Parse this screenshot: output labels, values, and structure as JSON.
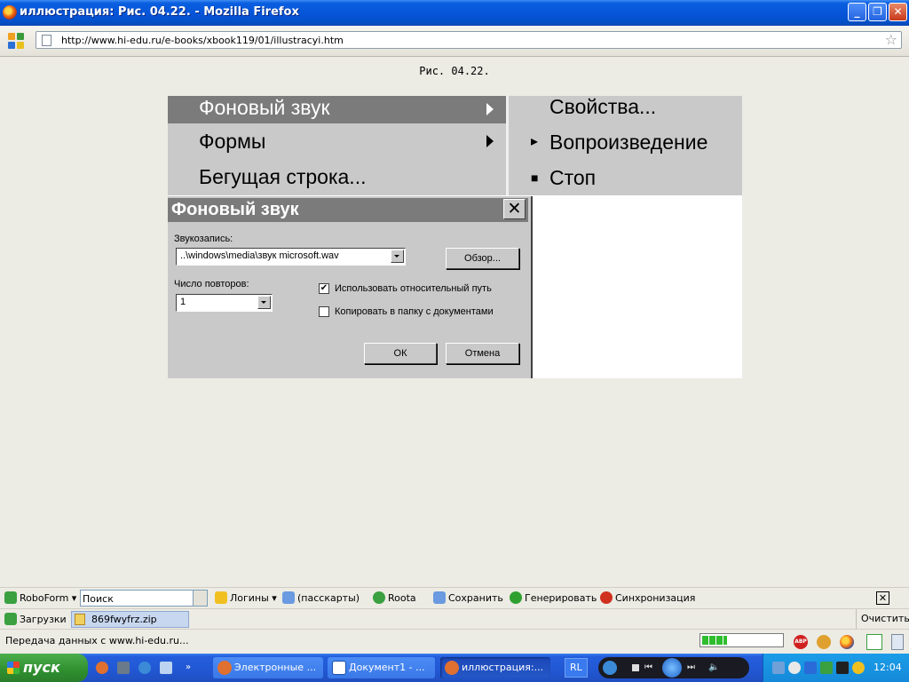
{
  "window": {
    "title": "иллюстрация: Рис. 04.22. - Mozilla Firefox",
    "btn_min": "_",
    "btn_max": "❐",
    "btn_close": "✕"
  },
  "nav": {
    "url": "http://www.hi-edu.ru/e-books/xbook119/01/illustracyi.htm",
    "bookmark_icon": "☆"
  },
  "page": {
    "caption": "Рис. 04.22.",
    "menu_left": [
      {
        "label": "Фоновый звук"
      },
      {
        "label": "Формы"
      },
      {
        "label": "Бегущая строка..."
      }
    ],
    "menu_right": [
      {
        "label": "Свойства...",
        "mark": ""
      },
      {
        "label": "Вопроизведение",
        "mark": "▸"
      },
      {
        "label": "Стоп",
        "mark": "■"
      }
    ],
    "dialog": {
      "title": "Фоновый звук",
      "close": "✕",
      "sound_label": "Звукозапись:",
      "sound_value": "..\\windows\\media\\звук microsoft.wav",
      "browse_btn": "Обзор...",
      "repeat_label": "Число повторов:",
      "repeat_value": "1",
      "use_relative_label": "Использовать относительный путь",
      "use_relative_checked": "✔",
      "copy_label": "Копировать в папку с документами",
      "ok_btn": "ОК",
      "cancel_btn": "Отмена"
    }
  },
  "roboform": {
    "name": "RoboForm",
    "search_value": "Поиск",
    "logins": "Логины",
    "passcards": "(пасскарты)",
    "roota": "Roota",
    "save": "Сохранить",
    "generate": "Генерировать",
    "sync": "Синхронизация",
    "close": "✕"
  },
  "downloads": {
    "label": "Загрузки",
    "file": "869fwyfrz.zip",
    "clear": "Очистить"
  },
  "status": {
    "text": "Передача данных с www.hi-edu.ru...",
    "progress_fraction": 0.32
  },
  "taskbar": {
    "start": "пуск",
    "buttons": [
      {
        "label": "Электронные ..."
      },
      {
        "label": "Документ1 - ..."
      },
      {
        "label": "иллюстрация:..."
      }
    ],
    "lang": "RL",
    "clock": "12:04"
  },
  "colors": {
    "menu_bg": "#c9c9c9",
    "menu_highlight": "#7b7b7b",
    "taskbar": "#245edc",
    "start_green": "#3b9a3b"
  }
}
